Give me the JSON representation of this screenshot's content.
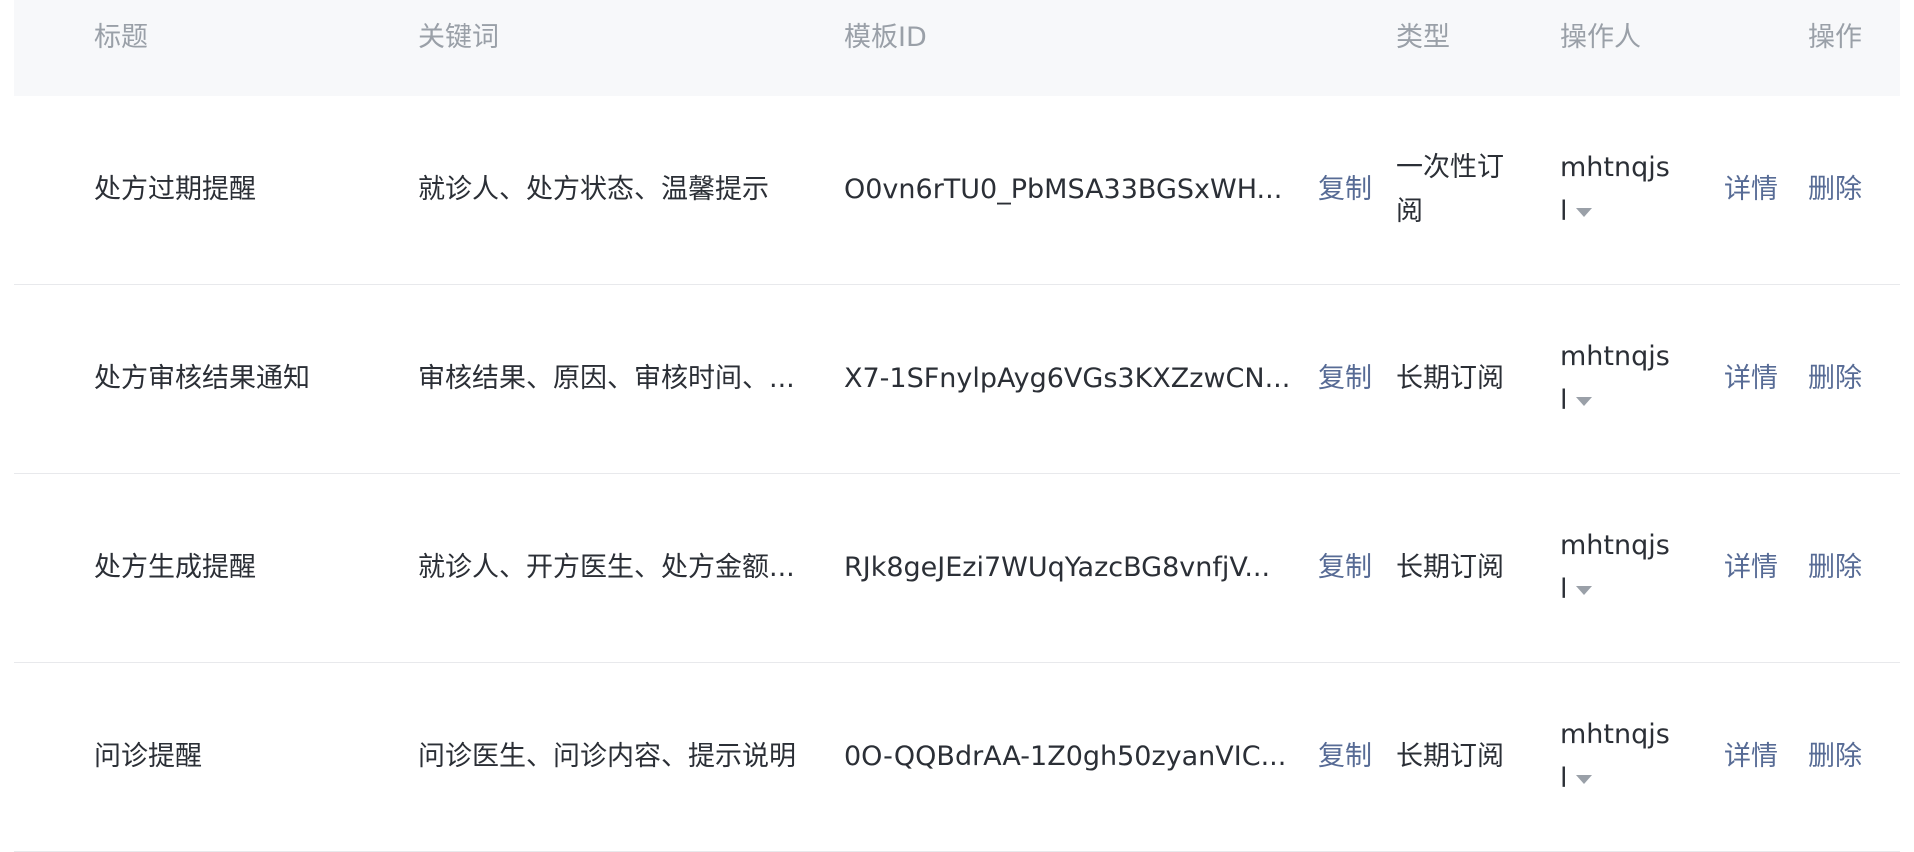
{
  "columns": {
    "title": "标题",
    "keywords": "关键词",
    "template_id": "模板ID",
    "type": "类型",
    "operator": "操作人",
    "actions": "操作"
  },
  "rows": [
    {
      "title": "处方过期提醒",
      "keywords": "就诊人、处方状态、温馨提示",
      "template_id": "O0vn6rTU0_PbMSA33BGSxWH...",
      "copy": "复制",
      "type": "一次性订阅",
      "operator_line1": "mhtnqjs",
      "operator_line2": "l",
      "detail": "详情",
      "delete": "删除"
    },
    {
      "title": "处方审核结果通知",
      "keywords": "审核结果、原因、审核时间、...",
      "template_id": "X7-1SFnylpAyg6VGs3KXZzwCN...",
      "copy": "复制",
      "type": "长期订阅",
      "operator_line1": "mhtnqjs",
      "operator_line2": "l",
      "detail": "详情",
      "delete": "删除"
    },
    {
      "title": "处方生成提醒",
      "keywords": "就诊人、开方医生、处方金额...",
      "template_id": "RJk8geJEzi7WUqYazcBG8vnfjV...",
      "copy": "复制",
      "type": "长期订阅",
      "operator_line1": "mhtnqjs",
      "operator_line2": "l",
      "detail": "详情",
      "delete": "删除"
    },
    {
      "title": "问诊提醒",
      "keywords": "问诊医生、问诊内容、提示说明",
      "template_id": "0O-QQBdrAA-1Z0gh50zyanVIC...",
      "copy": "复制",
      "type": "长期订阅",
      "operator_line1": "mhtnqjs",
      "operator_line2": "l",
      "detail": "详情",
      "delete": "删除"
    }
  ],
  "colors": {
    "link": "#576b95",
    "header_bg": "#f7f8fa",
    "header_text": "#9aa0a8",
    "body_text": "#2b2f36",
    "divider": "#e8e9ec"
  }
}
